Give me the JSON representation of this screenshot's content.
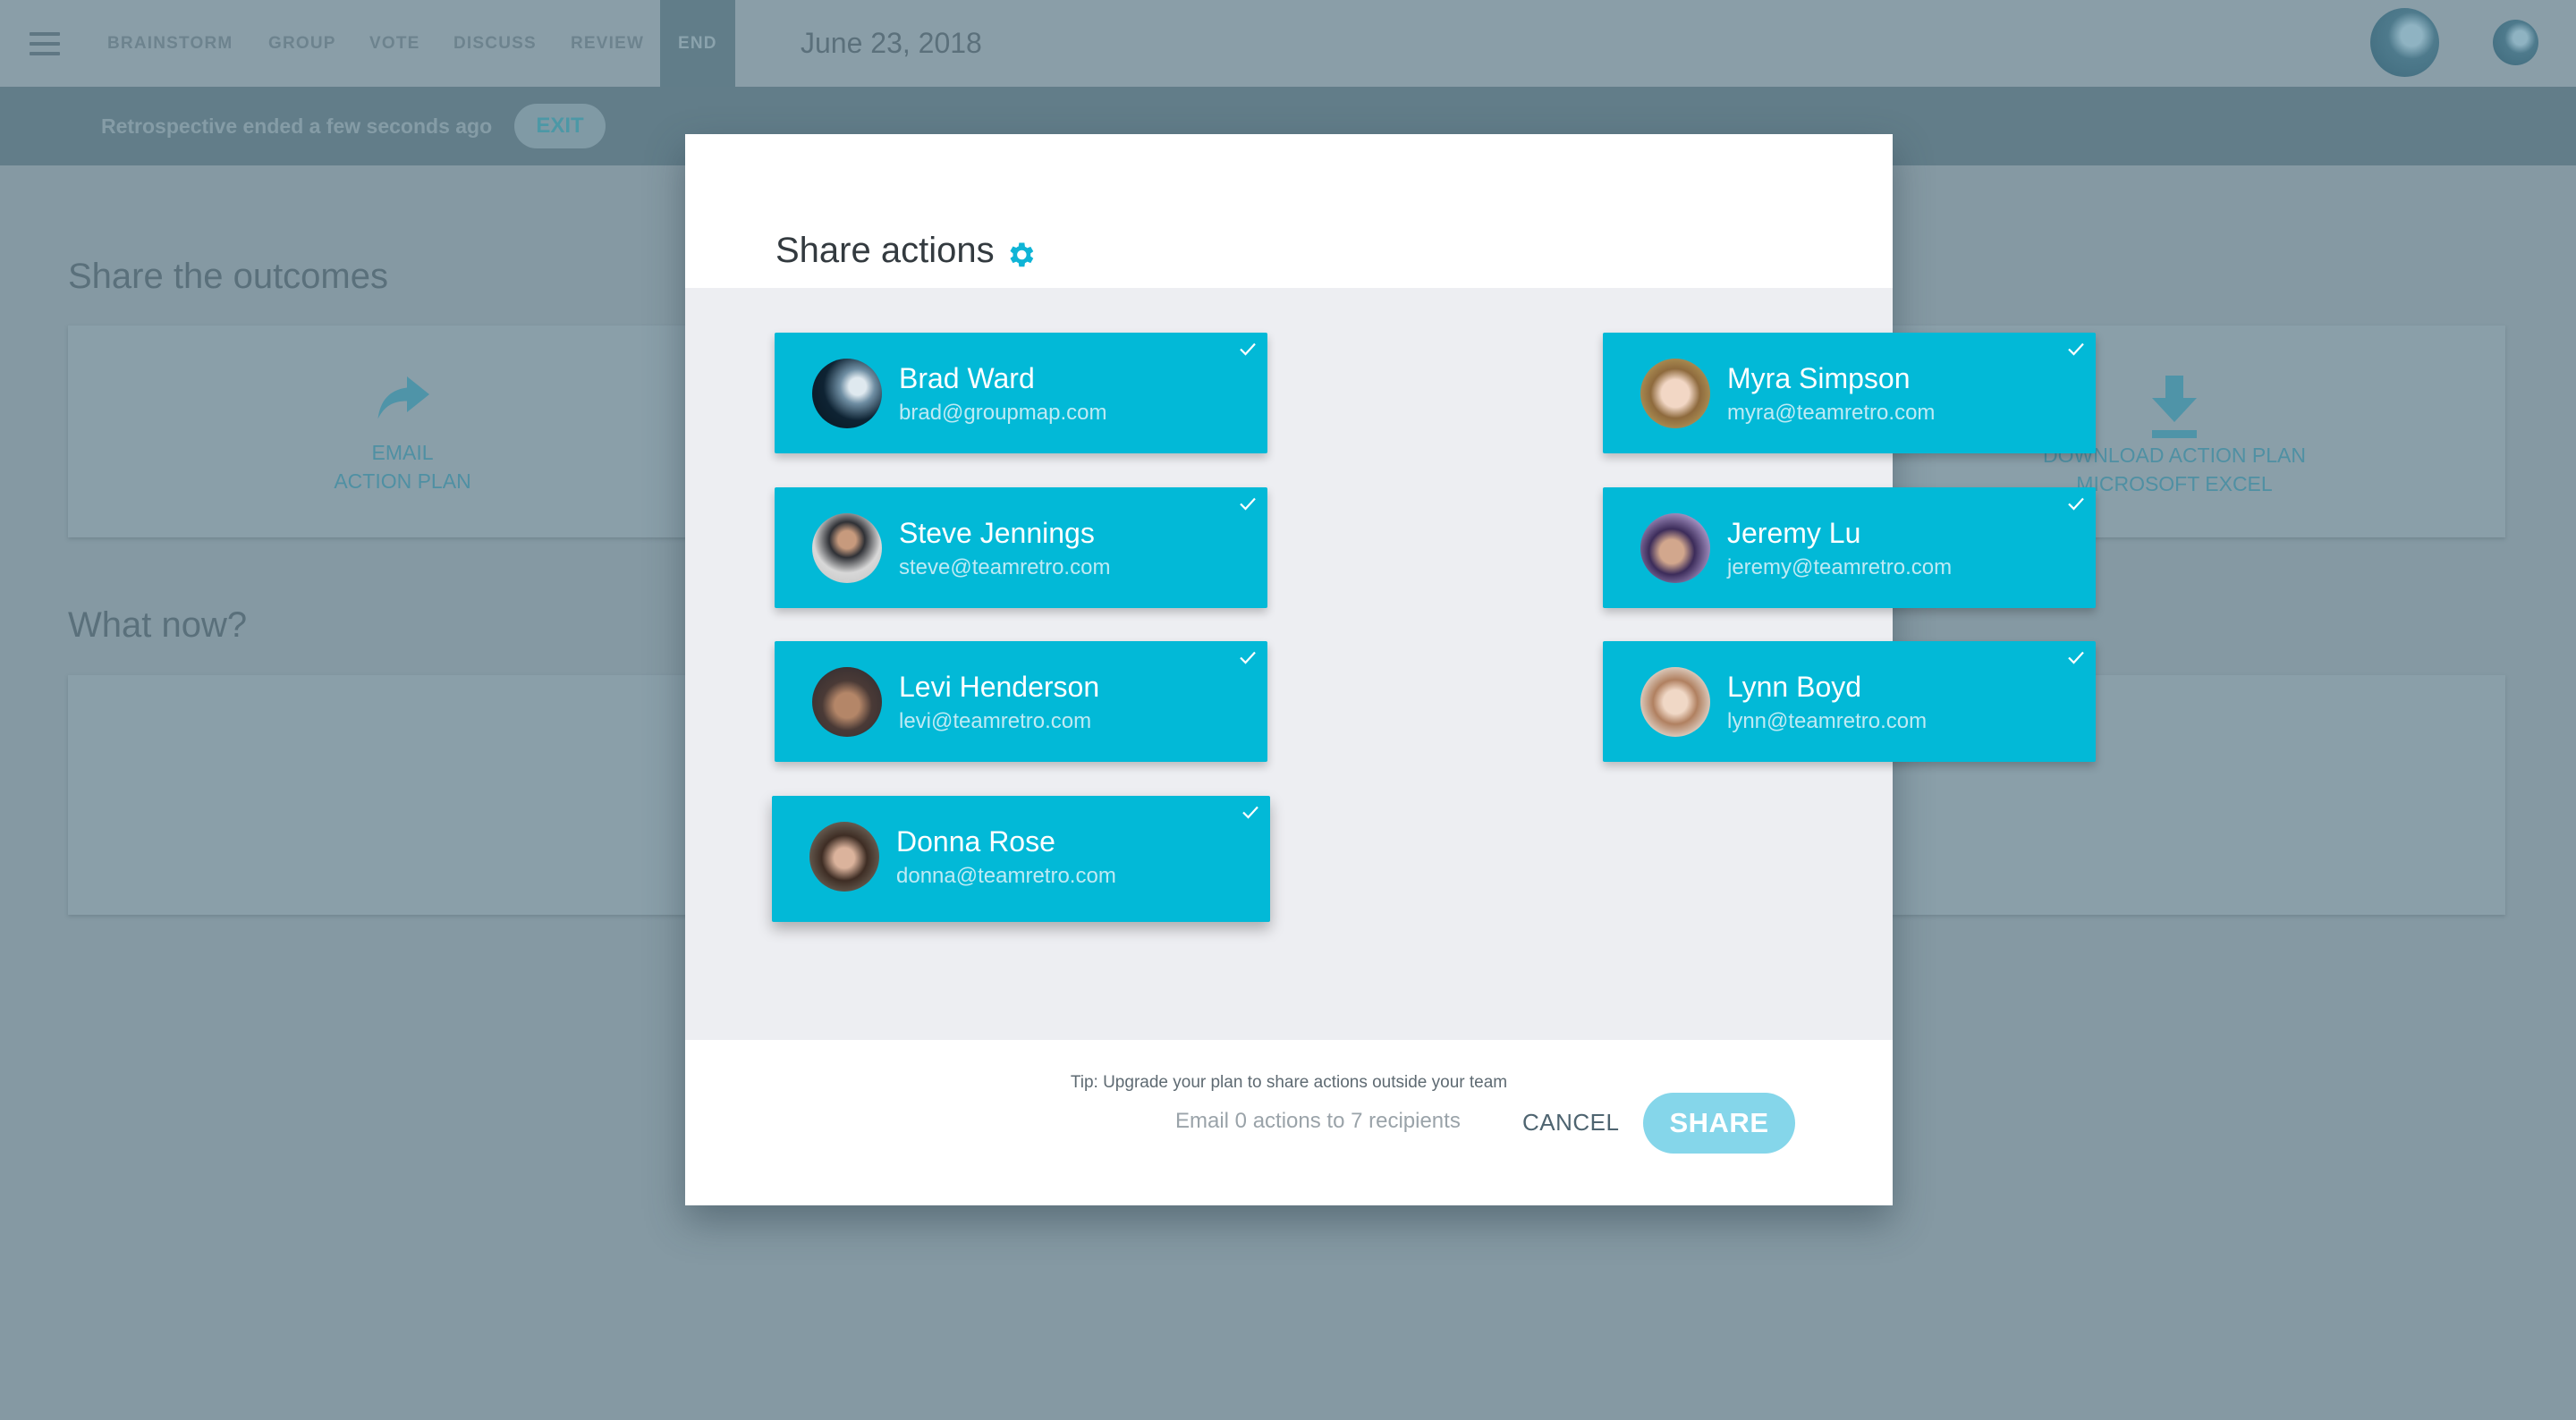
{
  "topbar": {
    "nav_tabs": [
      {
        "label": "BRAINSTORM",
        "active": false
      },
      {
        "label": "GROUP",
        "active": false
      },
      {
        "label": "VOTE",
        "active": false
      },
      {
        "label": "DISCUSS",
        "active": false
      },
      {
        "label": "REVIEW",
        "active": false
      },
      {
        "label": "END",
        "active": true
      }
    ],
    "date": "June 23, 2018",
    "icons": {
      "menu": "hamburger-menu-icon"
    }
  },
  "banner": {
    "status_text": "Retrospective ended a few seconds ago",
    "exit_label": "EXIT"
  },
  "background": {
    "share_title": "Share the outcomes",
    "email_option": {
      "line1": "EMAIL",
      "line2": "ACTION PLAN",
      "icon": "share-arrow-icon"
    },
    "download_option": {
      "line1": "DOWNLOAD ACTION PLAN",
      "line2": "MICROSOFT EXCEL",
      "icon": "download-icon"
    },
    "what_now_title": "What now?"
  },
  "modal": {
    "title": "Share actions",
    "title_icon": "gear-icon",
    "recipients": [
      {
        "name": "Brad Ward",
        "email": "brad@groupmap.com",
        "selected": true
      },
      {
        "name": "Myra Simpson",
        "email": "myra@teamretro.com",
        "selected": true
      },
      {
        "name": "Steve Jennings",
        "email": "steve@teamretro.com",
        "selected": true
      },
      {
        "name": "Jeremy Lu",
        "email": "jeremy@teamretro.com",
        "selected": true
      },
      {
        "name": "Levi Henderson",
        "email": "levi@teamretro.com",
        "selected": true
      },
      {
        "name": "Lynn Boyd",
        "email": "lynn@teamretro.com",
        "selected": true
      },
      {
        "name": "Donna Rose",
        "email": "donna@teamretro.com",
        "selected": true
      }
    ],
    "tip": "Tip: Upgrade your plan to share actions outside your team",
    "footer": {
      "summary": "Email 0 actions to 7 recipients",
      "cancel_label": "CANCEL",
      "share_label": "SHARE"
    }
  },
  "colors": {
    "accent": "#02b9d7",
    "share_button_disabled": "#85d6ea",
    "overlay": "#8599a3"
  }
}
